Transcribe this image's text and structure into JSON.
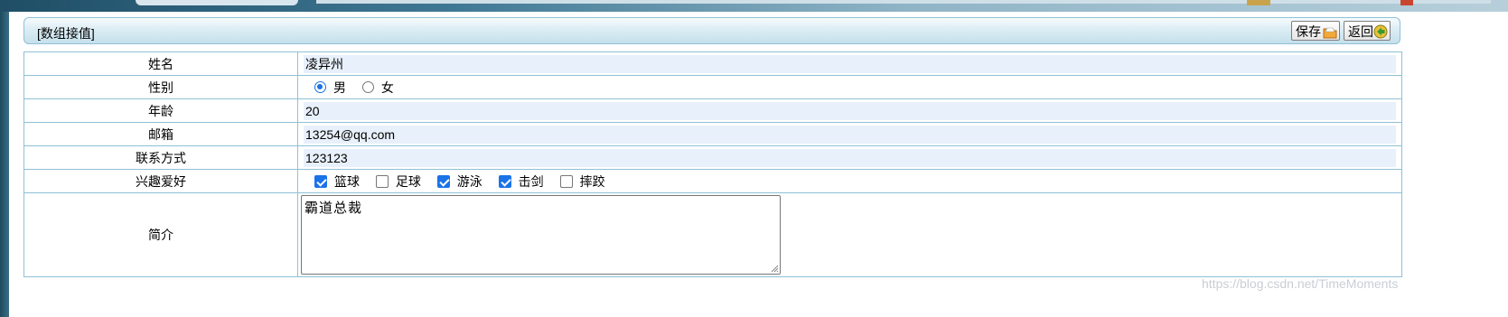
{
  "header": {
    "title": "[数组接值]",
    "save_label": "保存",
    "back_label": "返回"
  },
  "fields": {
    "name": {
      "label": "姓名",
      "value": "凌异州"
    },
    "gender": {
      "label": "性别",
      "options": [
        {
          "label": "男",
          "checked": true
        },
        {
          "label": "女",
          "checked": false
        }
      ]
    },
    "age": {
      "label": "年龄",
      "value": "20"
    },
    "email": {
      "label": "邮箱",
      "value": "13254@qq.com"
    },
    "contact": {
      "label": "联系方式",
      "value": "123123"
    },
    "hobbies": {
      "label": "兴趣爱好",
      "options": [
        {
          "label": "篮球",
          "checked": true
        },
        {
          "label": "足球",
          "checked": false
        },
        {
          "label": "游泳",
          "checked": true
        },
        {
          "label": "击剑",
          "checked": true
        },
        {
          "label": "摔跤",
          "checked": false
        }
      ]
    },
    "intro": {
      "label": "简介",
      "value": "霸道总裁"
    }
  },
  "watermark": "https://blog.csdn.net/TimeMoments",
  "colors": {
    "border": "#8fc1d6",
    "input_bg": "#e8f0fb",
    "accent": "#1a73e8"
  }
}
